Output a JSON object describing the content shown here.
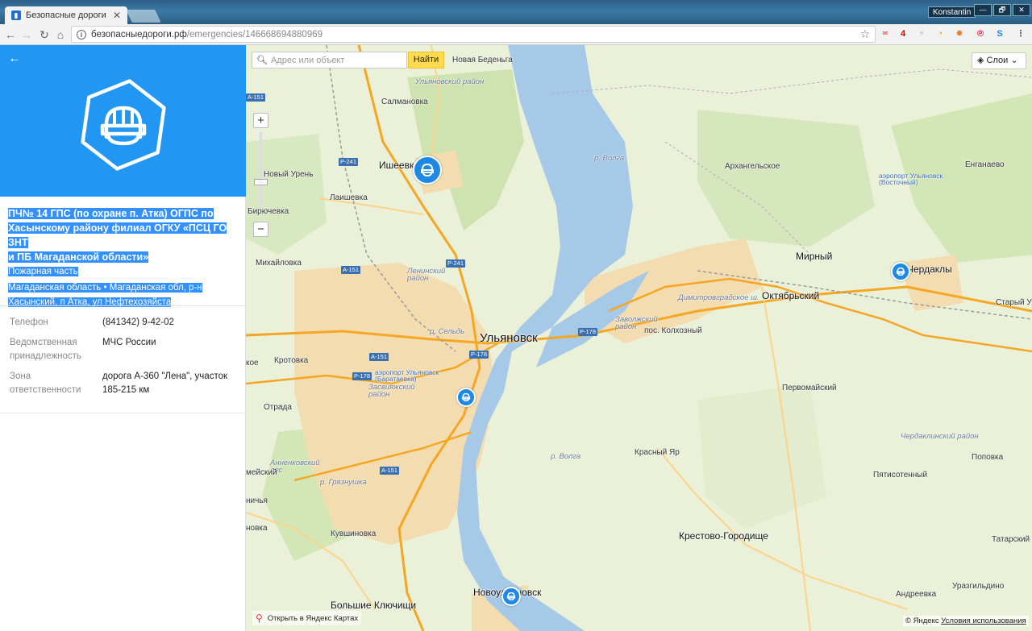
{
  "browser": {
    "tab_title": "Безопасные дороги",
    "tab_close": "✕",
    "profile": "Konstantin",
    "url_host": "безопасныедороги.рф",
    "url_path": "/emergencies/146668694880969",
    "window_controls": [
      "—",
      "🗗",
      "✕"
    ]
  },
  "sidebar": {
    "back": "←",
    "org_name": [
      "ПЧ№ 14 ГПС (по охране п. Атка) ОГПС по",
      "Хасынскому району филиал ОГКУ «ПСЦ ГО ЗНТ",
      "и ПБ Магаданской области»"
    ],
    "org_type": "Пожарная часть",
    "address": [
      "Магаданская область  •  Магаданская обл, р-н",
      "Хасынский, п Атка, ул Нефтехозяйста"
    ],
    "details": [
      {
        "label": "Телефон",
        "value": "(841342) 9-42-02"
      },
      {
        "label": "Ведомственная принадлежность",
        "value": "МЧС России"
      },
      {
        "label": "Зона ответственности",
        "value": "дорога А-360 \"Лена\", участок 185-215 км"
      }
    ],
    "header_color": "#2196f3"
  },
  "map": {
    "search_placeholder": "Адрес или объект",
    "find_button": "Найти",
    "layers_button": "Слои",
    "zoom_in": "+",
    "zoom_out": "−",
    "open_in_maps": "Открыть в Яндекс Картах",
    "copyright": "© Яндекс",
    "terms": "Условия использования",
    "labels": {
      "ulyanovsk": "Ульяновск",
      "novaya_bedenga": "Новая Беденьга",
      "ulyanovsky_rayon": "Ульяновский район",
      "salmanovka": "Салмановка",
      "isheevka": "Ишеевка",
      "novy_uren": "Новый Урень",
      "laishevka": "Лаишевка",
      "biryuchevka": "Бирючевка",
      "mikhailovka": "Михайловка",
      "leninsky": "Ленинский район",
      "krotovka": "Кротовка",
      "airport_baratayevka": "аэропорт Ульяновск (Баратаевка)",
      "zasviyazhsky": "Засвияжский район",
      "otrada": "Отрада",
      "annenkovsky": "Анненковский лес",
      "r_gryazsushka": "р. Грязнушка",
      "kuvshinovka": "Кувшиновка",
      "bolshie_klyuchishchi": "Большие Ключищи",
      "novoulyanovsk": "Новоульяновск",
      "zavolzhsky": "Заволжский район",
      "kolkhozny": "пос. Колхозный",
      "dimitrovgradskoe": "Димитровградское ш.",
      "oktyabrsky": "Октябрьский",
      "mirny": "Мирный",
      "arkhangelskoe": "Архангельское",
      "airport_vostochny": "аэропорт Ульяновск (Восточный)",
      "enganaevo": "Енганаево",
      "cherdakly": "Чердаклы",
      "stary_ur": "Старый Ур",
      "pervomaisky": "Первомайский",
      "cherdaklinsky": "Чердаклинский район",
      "krasny_yar": "Красный Яр",
      "popovka": "Поповка",
      "pyatisotenny": "Пятисотенный",
      "krestovo": "Крестово-Городище",
      "tatarsky": "Татарский",
      "urazgildino": "Уразгильдино",
      "andreevka": "Андреевка",
      "r_volga": "р. Волга",
      "r_selda": "р. Сельдь",
      "meysky": "мейский",
      "nichya": "ничья",
      "novka": "новка",
      "koe": "кое"
    },
    "roads": [
      "Р-241",
      "А-151",
      "Р-178"
    ],
    "colors": {
      "water": "#a7c9e8",
      "city": "#f3dcb0",
      "green": "#cfe3b0",
      "road": "#f5a623"
    }
  }
}
